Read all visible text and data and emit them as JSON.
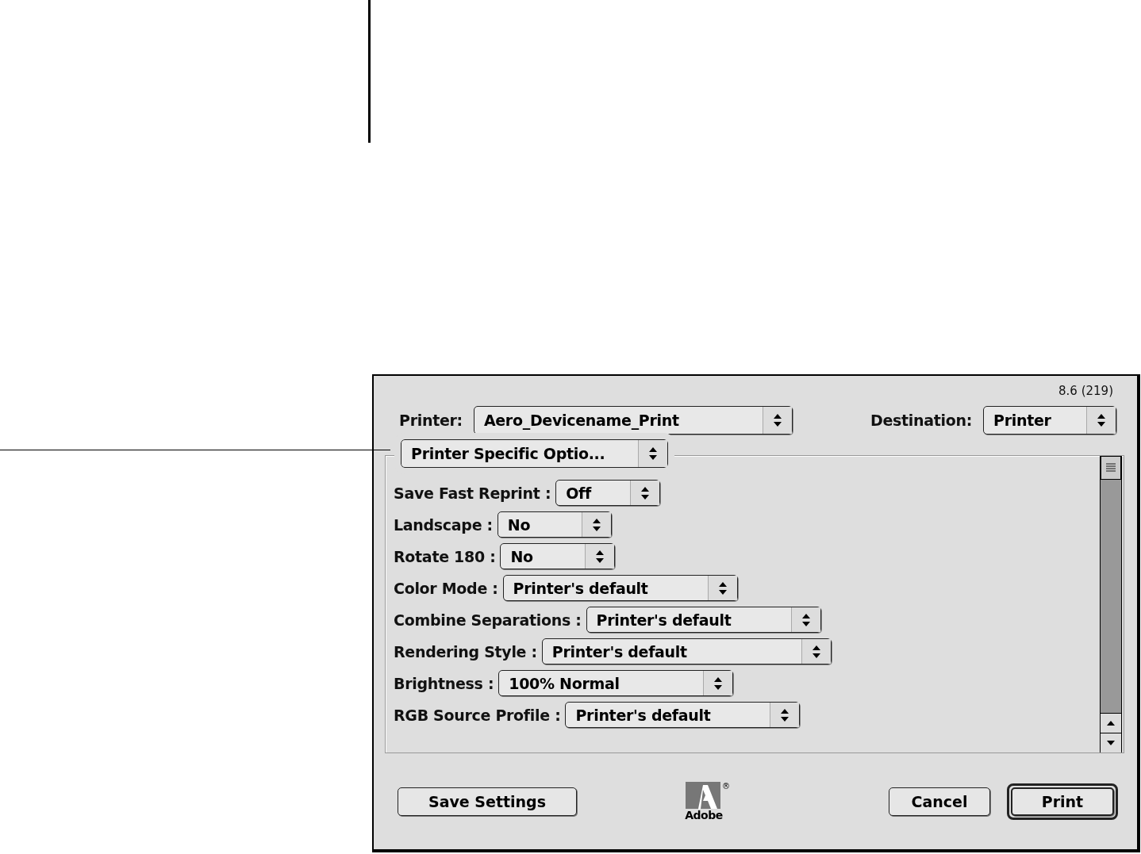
{
  "version": "8.6 (219)",
  "printer": {
    "label": "Printer:",
    "value": "Aero_Devicename_Print"
  },
  "destination": {
    "label": "Destination:",
    "value": "Printer"
  },
  "section": {
    "value": "Printer Specific Optio..."
  },
  "options": [
    {
      "label": "Save Fast Reprint :",
      "value": "Off"
    },
    {
      "label": "Landscape :",
      "value": "No"
    },
    {
      "label": "Rotate 180 :",
      "value": "No"
    },
    {
      "label": "Color Mode :",
      "value": "Printer's default"
    },
    {
      "label": "Combine Separations :",
      "value": "Printer's default"
    },
    {
      "label": "Rendering Style :",
      "value": "Printer's default"
    },
    {
      "label": "Brightness :",
      "value": "100% Normal"
    },
    {
      "label": "RGB Source Profile :",
      "value": "Printer's default"
    }
  ],
  "logo": {
    "wordmark": "Adobe",
    "mark": "®"
  },
  "buttons": [
    {
      "label": "Save Settings",
      "default": false
    },
    {
      "label": "Cancel",
      "default": false
    },
    {
      "label": "Print",
      "default": true
    }
  ]
}
